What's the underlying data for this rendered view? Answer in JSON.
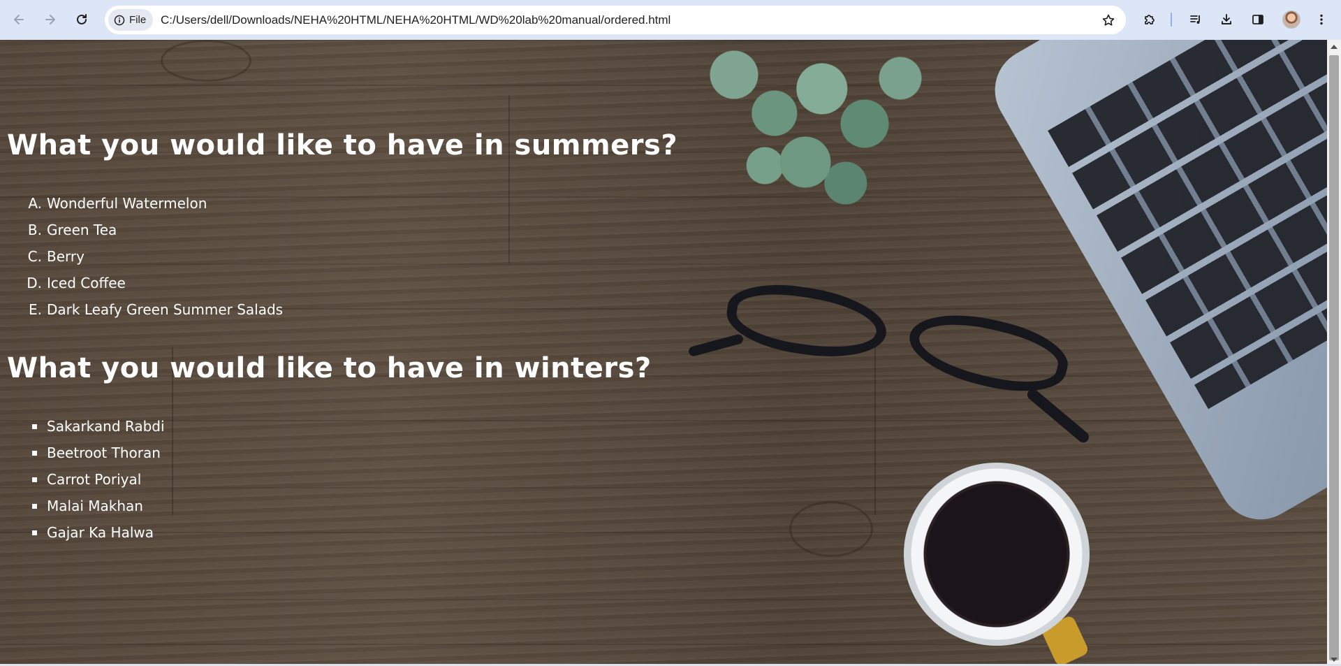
{
  "browser": {
    "site_chip": "File",
    "url": "C:/Users/dell/Downloads/NEHA%20HTML/NEHA%20HTML/WD%20lab%20manual/ordered.html"
  },
  "page": {
    "summer": {
      "heading": "What you would like to have in summers?",
      "items": [
        {
          "marker": "A.",
          "text": "Wonderful Watermelon"
        },
        {
          "marker": "B.",
          "text": "Green Tea"
        },
        {
          "marker": "C.",
          "text": "Berry"
        },
        {
          "marker": "D.",
          "text": "Iced Coffee"
        },
        {
          "marker": "E.",
          "text": "Dark Leafy Green Summer Salads"
        }
      ]
    },
    "winter": {
      "heading": "What you would like to have in winters?",
      "items": [
        {
          "text": "Sakarkand Rabdi"
        },
        {
          "text": "Beetroot Thoran"
        },
        {
          "text": "Carrot Poriyal"
        },
        {
          "text": "Malai Makhan"
        },
        {
          "text": "Gajar Ka Halwa"
        }
      ]
    }
  },
  "icons": {
    "back": "back-arrow-icon",
    "forward": "forward-arrow-icon",
    "reload": "reload-icon",
    "info": "info-icon",
    "bookmark": "star-icon",
    "extensions": "puzzle-icon",
    "media": "media-control-icon",
    "downloads": "download-icon",
    "side_panel": "side-panel-icon",
    "menu": "kebab-menu-icon"
  },
  "colors": {
    "toolbar_bg": "#dde6f6",
    "text": "#ffffff",
    "wood": "#55473a"
  }
}
